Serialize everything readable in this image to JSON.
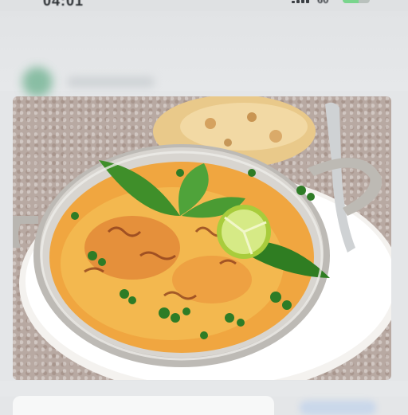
{
  "status_bar": {
    "time": "04:01",
    "battery_label": "60",
    "battery_level": 0.6,
    "signal_bars": 3,
    "accent_battery_color": "#7ad58d"
  },
  "header": {
    "app_icon": "app-icon",
    "app_icon_color": "#6bb08d"
  },
  "photo": {
    "subject_icon": "food-photo",
    "colors": {
      "curry": "#f0a640",
      "pot": "#c9c7c3",
      "plate": "#ffffff",
      "herbs": "#3f8f2a",
      "lime": "#b9d85a"
    }
  },
  "bottom": {
    "card_icon": "card",
    "button_color": "#c9d7ea"
  }
}
